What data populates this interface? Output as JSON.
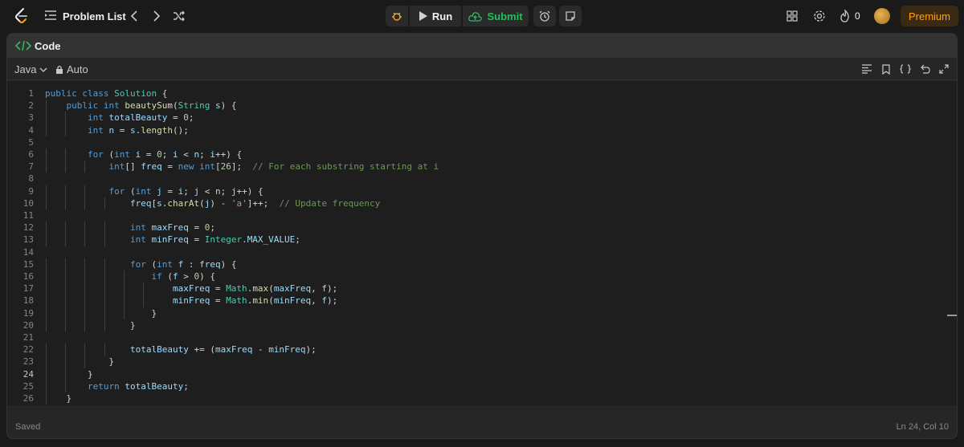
{
  "nav": {
    "problem_list": "Problem List"
  },
  "toolbar": {
    "run_label": "Run",
    "submit_label": "Submit"
  },
  "user": {
    "streak_count": "0",
    "premium_label": "Premium"
  },
  "panel": {
    "title": "Code",
    "language": "Java",
    "mode": "Auto"
  },
  "status": {
    "saved": "Saved",
    "cursor": "Ln 24, Col 10"
  },
  "colors": {
    "accent_green": "#2cbb5d",
    "premium_orange": "#ffa116",
    "keyword": "#569cd6",
    "type": "#4ec9b0",
    "function": "#dcdcaa",
    "variable": "#9cdcfe",
    "number": "#b5cea8",
    "string": "#ce9178",
    "comment": "#6a9955"
  },
  "editor": {
    "current_line": 24,
    "lines": [
      "public class Solution {",
      "    public int beautySum(String s) {",
      "        int totalBeauty = 0;",
      "        int n = s.length();",
      "",
      "        for (int i = 0; i < n; i++) {",
      "            int[] freq = new int[26];  // For each substring starting at i",
      "",
      "            for (int j = i; j < n; j++) {",
      "                freq[s.charAt(j) - 'a']++;  // Update frequency",
      "",
      "                int maxFreq = 0;",
      "                int minFreq = Integer.MAX_VALUE;",
      "",
      "                for (int f : freq) {",
      "                    if (f > 0) {",
      "                        maxFreq = Math.max(maxFreq, f);",
      "                        minFreq = Math.min(minFreq, f);",
      "                    }",
      "                }",
      "",
      "                totalBeauty += (maxFreq - minFreq);",
      "            }",
      "        }",
      "        return totalBeauty;",
      "    }",
      "}"
    ]
  }
}
